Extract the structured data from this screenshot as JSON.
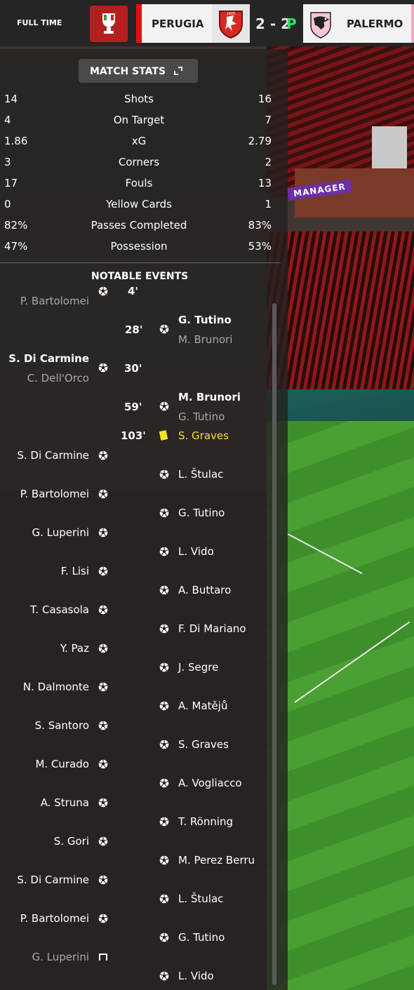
{
  "header": {
    "status": "FULL TIME",
    "home_team": "PERUGIA",
    "away_team": "PALERMO",
    "score": "2 - 2",
    "penalties_indicator": "P",
    "colors": {
      "home_accent": "#e01010",
      "away_accent": "#f6a9c8",
      "penalty_marker": "#2ee06a"
    },
    "icons": {
      "competition": "coppa-italia-badge-icon",
      "home_crest": "griffin-crest-icon",
      "away_crest": "eagle-crest-icon"
    }
  },
  "match_stats": {
    "title": "MATCH STATS",
    "rows": [
      {
        "label": "Shots",
        "home": "14",
        "away": "16"
      },
      {
        "label": "On Target",
        "home": "4",
        "away": "7"
      },
      {
        "label": "xG",
        "home": "1.86",
        "away": "2.79"
      },
      {
        "label": "Corners",
        "home": "3",
        "away": "2"
      },
      {
        "label": "Fouls",
        "home": "17",
        "away": "13"
      },
      {
        "label": "Yellow Cards",
        "home": "0",
        "away": "1"
      },
      {
        "label": "Passes Completed",
        "home": "82%",
        "away": "83%"
      },
      {
        "label": "Possession",
        "home": "47%",
        "away": "53%"
      }
    ]
  },
  "notable_events": {
    "title": "NOTABLE EVENTS",
    "goals": [
      {
        "minute": "4'",
        "team": "home",
        "scorer": "",
        "assist": "P. Bartolomei"
      },
      {
        "minute": "28'",
        "team": "away",
        "scorer": "G. Tutino",
        "assist": "M. Brunori"
      },
      {
        "minute": "30'",
        "team": "home",
        "scorer": "S. Di Carmine",
        "assist": "C. Dell'Orco"
      },
      {
        "minute": "59'",
        "team": "away",
        "scorer": "M. Brunori",
        "assist": "G. Tutino"
      }
    ],
    "card": {
      "minute": "103'",
      "player": "S. Graves",
      "type": "yellow-card-icon"
    },
    "shootout_home": [
      {
        "player": "S. Di Carmine",
        "result": "scored"
      },
      {
        "player": "P. Bartolomei",
        "result": "scored"
      },
      {
        "player": "G. Luperini",
        "result": "scored"
      },
      {
        "player": "F. Lisi",
        "result": "scored"
      },
      {
        "player": "T. Casasola",
        "result": "scored"
      },
      {
        "player": "Y. Paz",
        "result": "scored"
      },
      {
        "player": "N. Dalmonte",
        "result": "scored"
      },
      {
        "player": "S. Santoro",
        "result": "scored"
      },
      {
        "player": "M. Curado",
        "result": "scored"
      },
      {
        "player": "A. Struna",
        "result": "scored"
      },
      {
        "player": "S. Gori",
        "result": "scored"
      },
      {
        "player": "S. Di Carmine",
        "result": "scored"
      },
      {
        "player": "P. Bartolomei",
        "result": "scored"
      },
      {
        "player": "G. Luperini",
        "result": "missed"
      }
    ],
    "shootout_away": [
      {
        "player": "L. Štulac",
        "result": "scored"
      },
      {
        "player": "G. Tutino",
        "result": "scored"
      },
      {
        "player": "L. Vido",
        "result": "scored"
      },
      {
        "player": "A. Buttaro",
        "result": "scored"
      },
      {
        "player": "F. Di Mariano",
        "result": "scored"
      },
      {
        "player": "J. Segre",
        "result": "scored"
      },
      {
        "player": "A. Matějů",
        "result": "scored"
      },
      {
        "player": "S. Graves",
        "result": "scored"
      },
      {
        "player": "A. Vogliacco",
        "result": "scored"
      },
      {
        "player": "T. Rönning",
        "result": "scored"
      },
      {
        "player": "M. Perez Berru",
        "result": "scored"
      },
      {
        "player": "L. Štulac",
        "result": "scored"
      },
      {
        "player": "G. Tutino",
        "result": "scored"
      },
      {
        "player": "L. Vido",
        "result": "scored"
      }
    ]
  },
  "background": {
    "banner_text": "MANAGER"
  }
}
